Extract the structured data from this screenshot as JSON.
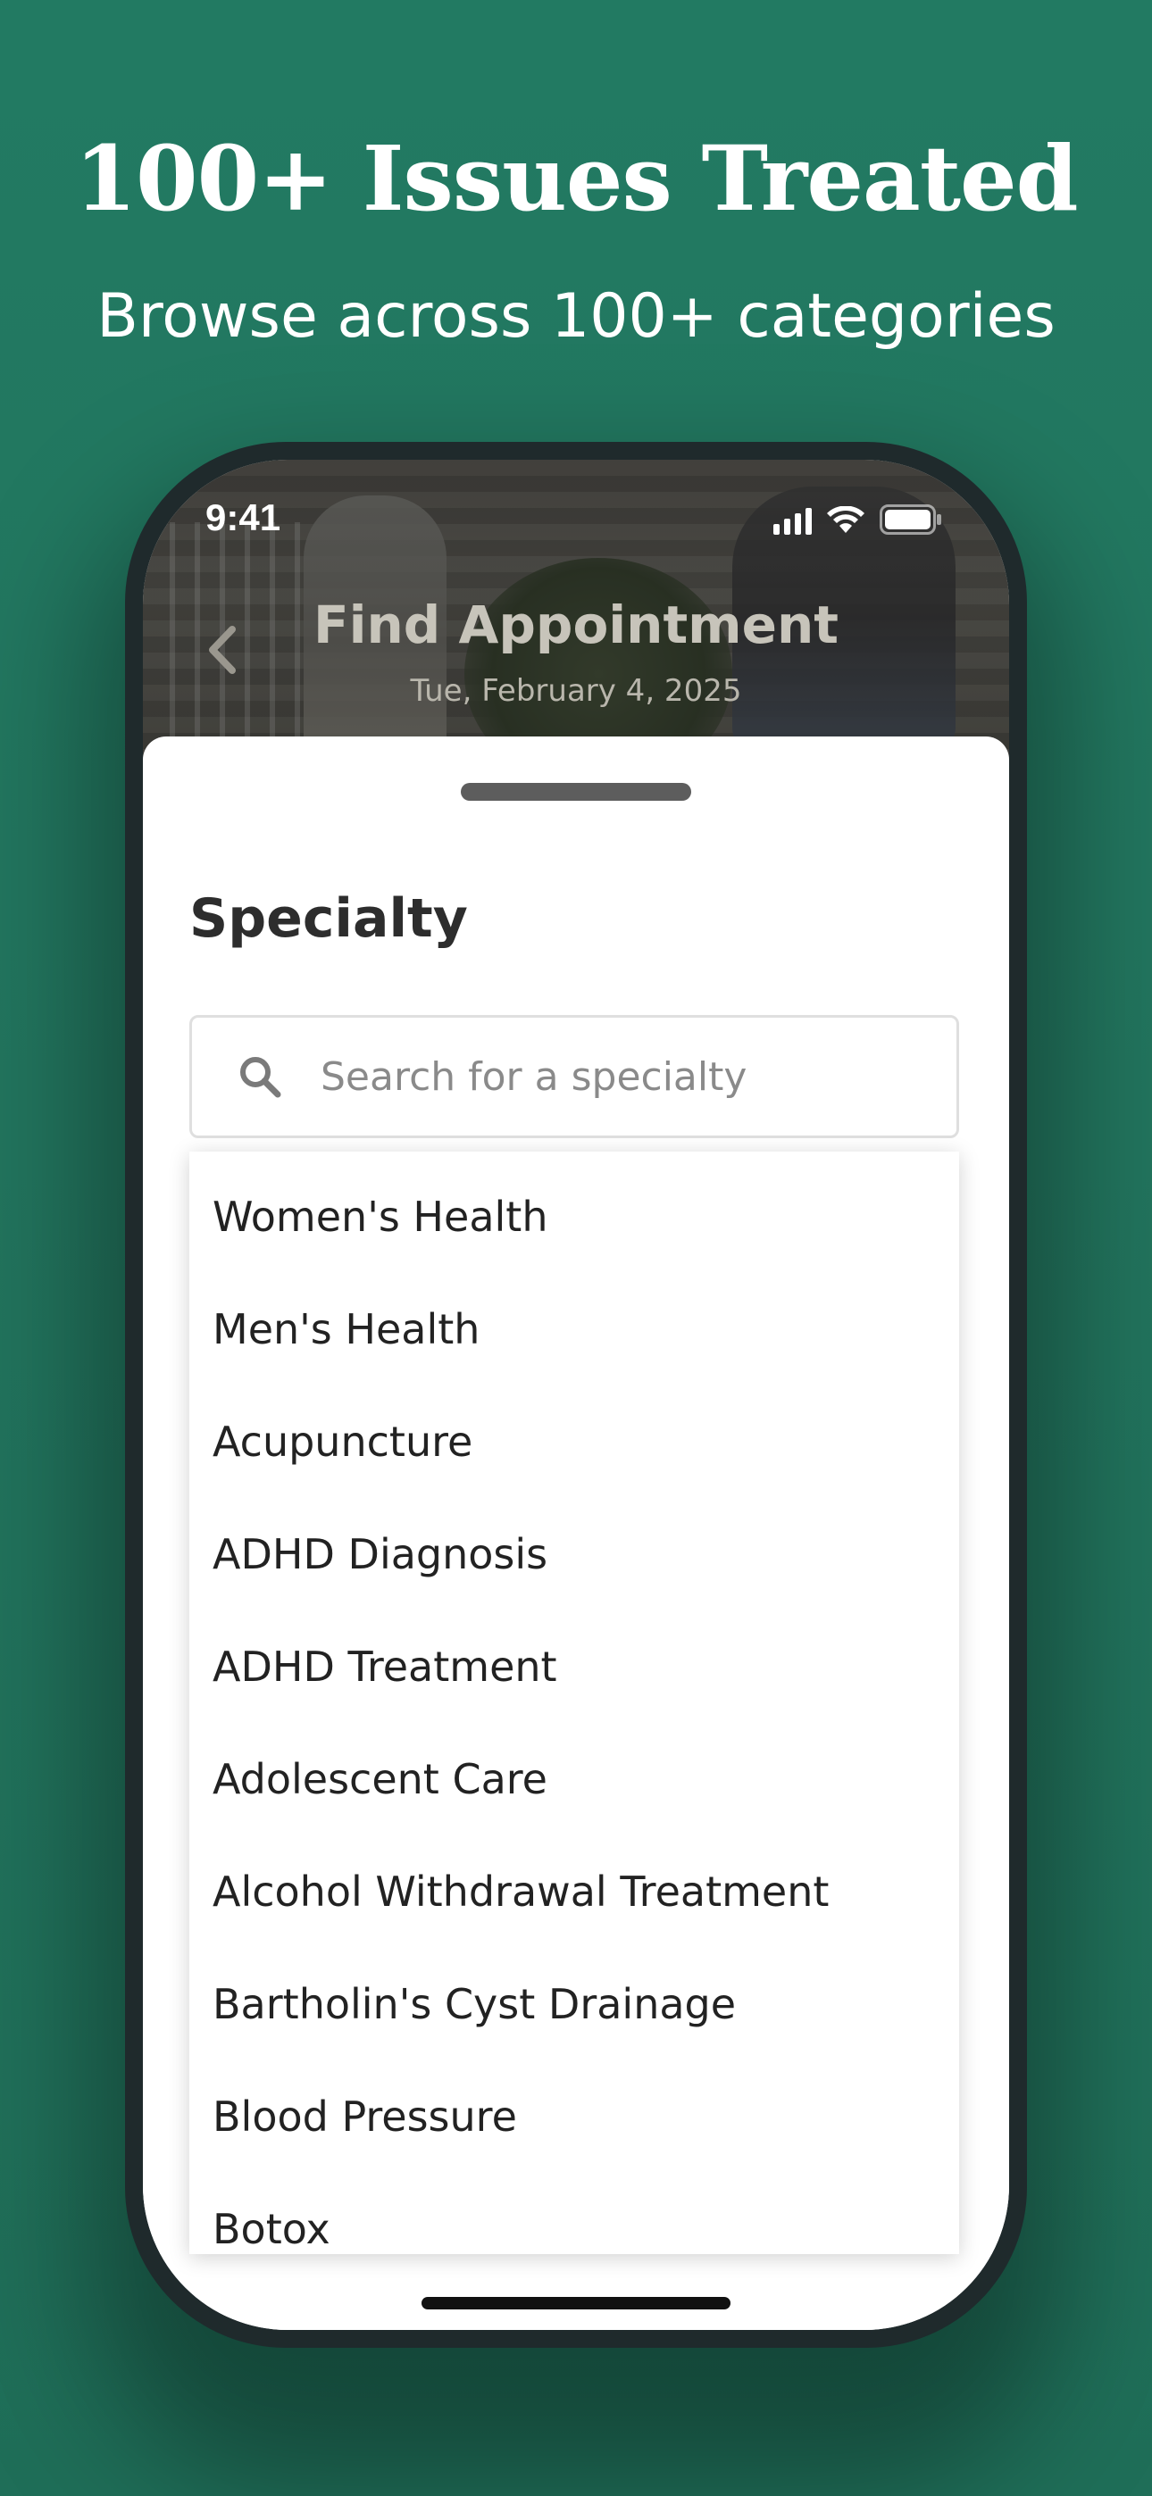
{
  "promo": {
    "title": "100+ Issues Treated",
    "subtitle": "Browse across 100+ categories"
  },
  "status_bar": {
    "time": "9:41",
    "icons": [
      "signal-icon",
      "wifi-icon",
      "battery-icon"
    ]
  },
  "nav": {
    "back_icon": "chevron-left-icon",
    "title": "Find Appointment",
    "subtitle": "Tue, February 4, 2025"
  },
  "sheet": {
    "title": "Specialty",
    "search": {
      "icon": "search-icon",
      "placeholder": "Search for a specialty",
      "value": ""
    },
    "items": [
      {
        "label": "Women's Health"
      },
      {
        "label": "Men's Health"
      },
      {
        "label": "Acupuncture"
      },
      {
        "label": "ADHD Diagnosis"
      },
      {
        "label": "ADHD Treatment"
      },
      {
        "label": "Adolescent Care"
      },
      {
        "label": "Alcohol Withdrawal Treatment"
      },
      {
        "label": "Bartholin's Cyst Drainage"
      },
      {
        "label": "Blood Pressure"
      },
      {
        "label": "Botox"
      }
    ]
  },
  "colors": {
    "background": "#227a62",
    "phone_frame": "#1f2a2c",
    "sheet": "#ffffff",
    "text_dark": "#222222",
    "placeholder": "#8a8a8a"
  }
}
